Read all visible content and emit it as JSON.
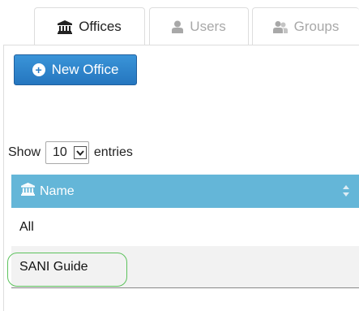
{
  "tabs": [
    {
      "label": "Offices",
      "icon": "institution-icon",
      "active": true
    },
    {
      "label": "Users",
      "icon": "user-icon",
      "active": false
    },
    {
      "label": "Groups",
      "icon": "users-icon",
      "active": false
    }
  ],
  "toolbar": {
    "new_office_label": "New Office",
    "new_office_icon": "plus-circle-icon"
  },
  "table_length": {
    "prefix": "Show",
    "value": "10",
    "suffix": "entries"
  },
  "table": {
    "header": {
      "label": "Name",
      "icon": "institution-icon",
      "sort_icon": "sort-icon"
    },
    "rows": [
      {
        "name": "All"
      },
      {
        "name": "SANI Guide"
      }
    ]
  },
  "colors": {
    "header_bg": "#64b6d8",
    "button_bg": "#2a7cc4",
    "highlight": "#5cc25c",
    "inactive_tab_text": "#a8a8a8"
  }
}
